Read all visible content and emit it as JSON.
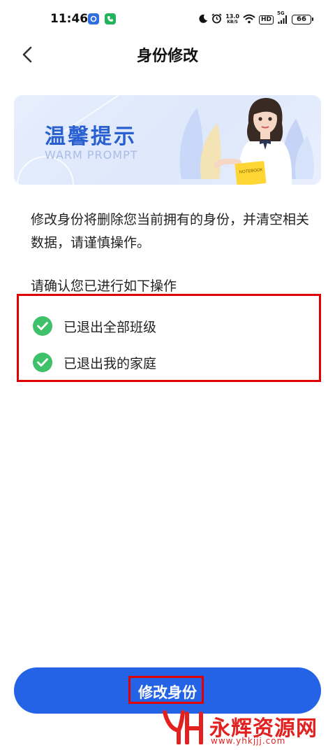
{
  "status_bar": {
    "time": "11:46",
    "network_speed_value": "13.0",
    "network_speed_unit": "KB/S",
    "hd_badge": "HD",
    "signal_label": "5G",
    "battery_level": "66"
  },
  "nav": {
    "title": "身份修改"
  },
  "banner": {
    "title": "温馨提示",
    "subtitle": "WARM PROMPT",
    "notebook_label": "NOTEBOOK"
  },
  "notice": {
    "text": "修改身份将删除您当前拥有的身份，并清空相关数据，请谨慎操作。"
  },
  "confirm": {
    "heading": "请确认您已进行如下操作",
    "items": [
      {
        "label": "已退出全部班级",
        "checked": true
      },
      {
        "label": "已退出我的家庭",
        "checked": true
      }
    ]
  },
  "footer": {
    "submit_label": "修改身份"
  },
  "watermark": {
    "brand": "永辉资源网",
    "url": "www.yhkjjj.com"
  },
  "colors": {
    "accent": "#2563e6",
    "check": "#3fc06a",
    "highlight": "#e00000",
    "banner_title": "#2a5fd1"
  }
}
